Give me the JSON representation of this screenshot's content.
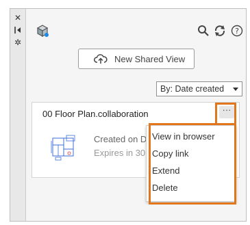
{
  "toolbar": {
    "app_icon": "cube-share-icon",
    "search_icon": "search-icon",
    "refresh_icon": "refresh-icon",
    "help_icon": "help-icon"
  },
  "side_strip": {
    "close_icon": "close-icon",
    "collapse_icon": "collapse-icon",
    "settings_icon": "gear-icon"
  },
  "share_button": {
    "label": "New Shared View",
    "icon": "cloud-upload-icon"
  },
  "sort": {
    "selected": "By: Date created"
  },
  "cards": [
    {
      "title": "00 Floor Plan.collaboration",
      "created": "Created on Dec",
      "expires": "Expires in 30 da",
      "thumb_icon": "floor-plan-thumbnail",
      "more_label": "···"
    }
  ],
  "context_menu": {
    "items": [
      {
        "label": "View in browser"
      },
      {
        "label": "Copy link"
      },
      {
        "label": "Extend"
      },
      {
        "label": "Delete"
      }
    ]
  },
  "colors": {
    "highlight": "#e2761d",
    "panel_bg": "#f5f5f5"
  }
}
